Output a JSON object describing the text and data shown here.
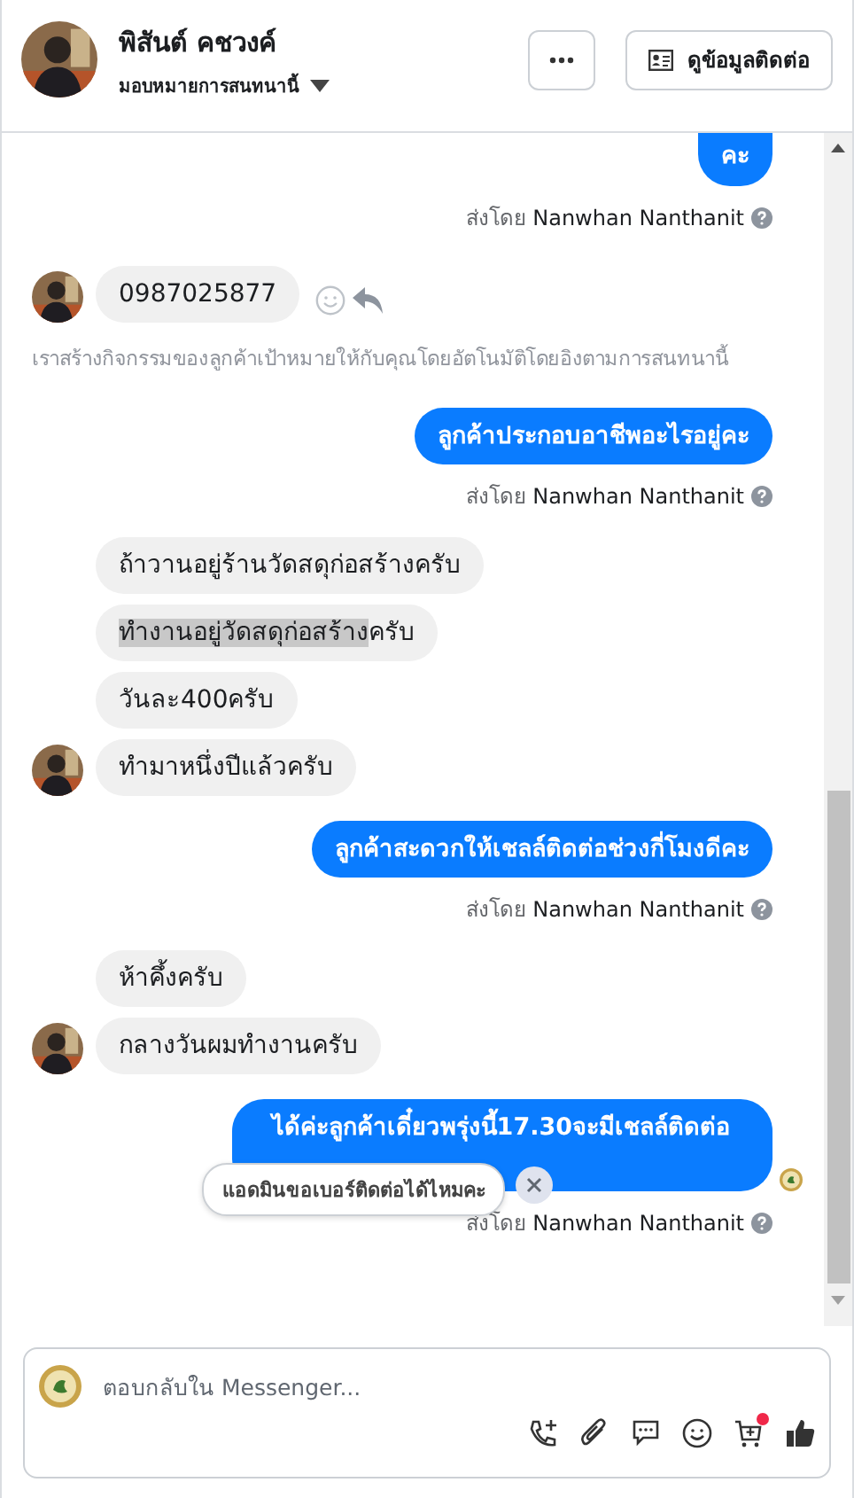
{
  "header": {
    "name": "พิสันต์ คชวงค์",
    "assign_label": "มอบหมายการสนทนานี้",
    "contact_button": "ดูข้อมูลติดต่อ"
  },
  "messages": [
    {
      "kind": "out",
      "cut_top": true,
      "text": "คะ",
      "sent_by": "ส่งโดย **Nanwhan Nanthanit**",
      "seen": false
    },
    {
      "kind": "in",
      "avatar": true,
      "actions": true,
      "text": "0987025877"
    },
    {
      "kind": "system",
      "text": "เราสร้างกิจกรรมของลูกค้าเป้าหมายให้กับคุณโดยอัตโนมัติโดยอิงตามการสนทนานี้"
    },
    {
      "kind": "out",
      "cut_top": false,
      "text": "ลูกค้าประกอบอาชีพอะไรอยู่คะ",
      "sent_by": "ส่งโดย **Nanwhan Nanthanit**",
      "seen": false
    },
    {
      "kind": "in",
      "avatar": false,
      "actions": false,
      "text": "ถ้าวานอยู่ร้านวัดสดุก่อสร้างครับ"
    },
    {
      "kind": "in",
      "avatar": false,
      "actions": false,
      "parts": [
        {
          "text": "ทำงานอยู่วัดสดุก่อสร้าง",
          "selected": true
        },
        {
          "text": "ครับ",
          "selected": false
        }
      ]
    },
    {
      "kind": "in",
      "avatar": false,
      "actions": false,
      "text": "วันละ400ครับ"
    },
    {
      "kind": "in",
      "avatar": true,
      "actions": false,
      "text": "ทำมาหนึ่งปีแล้วครับ"
    },
    {
      "kind": "out",
      "cut_top": false,
      "text": "ลูกค้าสะดวกให้เชลล์ติดต่อช่วงกี่โมงดีคะ",
      "sent_by": "ส่งโดย **Nanwhan Nanthanit**",
      "seen": false
    },
    {
      "kind": "in",
      "avatar": false,
      "actions": false,
      "text": "ห้าคึ้งครับ"
    },
    {
      "kind": "in",
      "avatar": true,
      "actions": false,
      "text": "กลางวันผมทำงานครับ"
    },
    {
      "kind": "out",
      "cut_top": false,
      "text": "ได้ค่ะลูกค้าเดี๋ยวพรุ่งนี้17.30จะมีเชลล์ติดต่อ",
      "sent_by": "ส่งโดย **Nanwhan Nanthanit**",
      "seen": true,
      "suggestion": "แอดมินขอเบอร์ติดต่อได้ไหมคะ"
    }
  ],
  "composer": {
    "placeholder": "ตอบกลับใน Messenger...",
    "cart_badge": true
  }
}
